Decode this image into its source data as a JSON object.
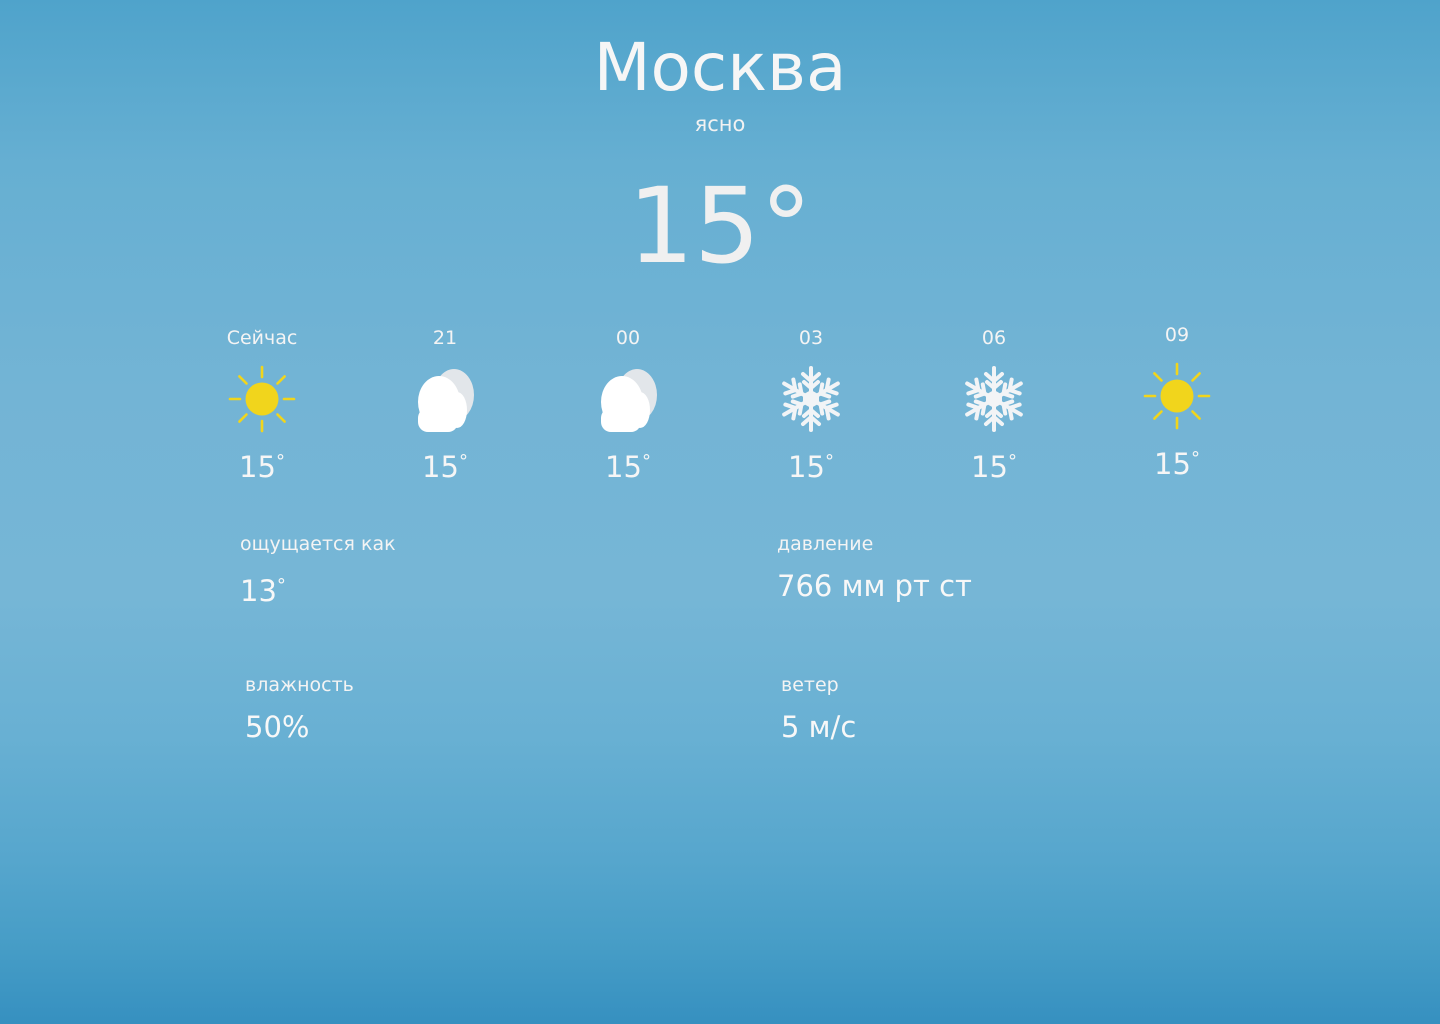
{
  "location": {
    "city": "Москва",
    "condition": "ясно",
    "temperature": "15°"
  },
  "hourly": [
    {
      "time": "Сейчас",
      "icon": "sun-icon",
      "temp": "15",
      "deg": "°"
    },
    {
      "time": "21",
      "icon": "cloud-icon",
      "temp": "15",
      "deg": "°"
    },
    {
      "time": "00",
      "icon": "cloud-icon",
      "temp": "15",
      "deg": "°"
    },
    {
      "time": "03",
      "icon": "snowflake-icon",
      "temp": "15",
      "deg": "°"
    },
    {
      "time": "06",
      "icon": "snowflake-icon",
      "temp": "15",
      "deg": "°"
    },
    {
      "time": "09",
      "icon": "sun-icon",
      "temp": "15",
      "deg": "°"
    }
  ],
  "details": {
    "feels_like": {
      "label": "ощущается как",
      "value": "13",
      "deg": "°"
    },
    "pressure": {
      "label": "давление",
      "value": "766 мм рт ст"
    },
    "humidity": {
      "label": "влажность",
      "value": "50%"
    },
    "wind": {
      "label": "ветер",
      "value": "5 м/с"
    }
  },
  "colors": {
    "sun": "#f1d51c",
    "cloud": "#ffffff",
    "snow": "#f2f4f6",
    "background_top": "#4fa3cb",
    "background_bottom": "#3690c0"
  }
}
